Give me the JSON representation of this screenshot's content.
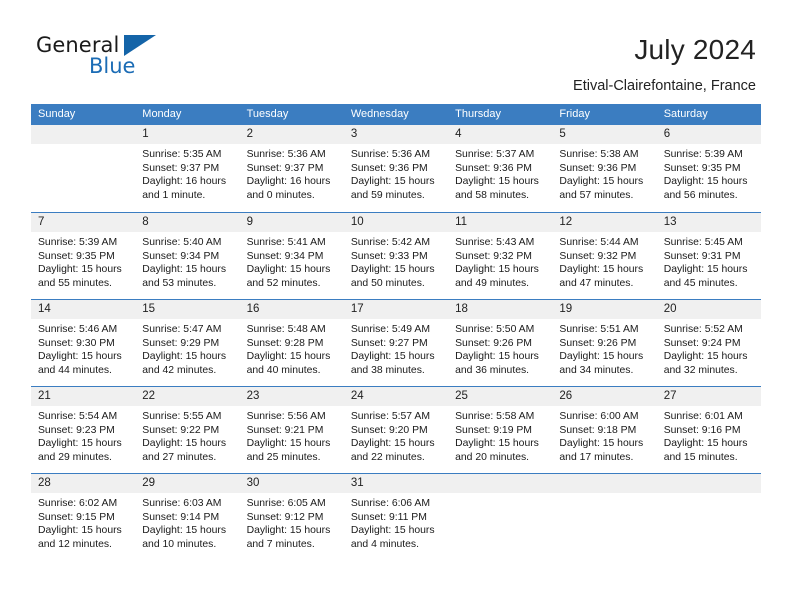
{
  "brand": {
    "name_part1": "General",
    "name_part2": "Blue",
    "triangle_icon": "triangle-icon",
    "accent_color": "#1464a8"
  },
  "header": {
    "title": "July 2024",
    "subtitle": "Etival-Clairefontaine, France"
  },
  "calendar": {
    "header_bg_color": "#3b7dc1",
    "daynum_bg_color": "#f0f0f0",
    "weekdays": [
      "Sunday",
      "Monday",
      "Tuesday",
      "Wednesday",
      "Thursday",
      "Friday",
      "Saturday"
    ],
    "weeks": [
      [
        {
          "day": "",
          "sunrise": "",
          "sunset": "",
          "daylight": ""
        },
        {
          "day": "1",
          "sunrise": "Sunrise: 5:35 AM",
          "sunset": "Sunset: 9:37 PM",
          "daylight": "Daylight: 16 hours and 1 minute."
        },
        {
          "day": "2",
          "sunrise": "Sunrise: 5:36 AM",
          "sunset": "Sunset: 9:37 PM",
          "daylight": "Daylight: 16 hours and 0 minutes."
        },
        {
          "day": "3",
          "sunrise": "Sunrise: 5:36 AM",
          "sunset": "Sunset: 9:36 PM",
          "daylight": "Daylight: 15 hours and 59 minutes."
        },
        {
          "day": "4",
          "sunrise": "Sunrise: 5:37 AM",
          "sunset": "Sunset: 9:36 PM",
          "daylight": "Daylight: 15 hours and 58 minutes."
        },
        {
          "day": "5",
          "sunrise": "Sunrise: 5:38 AM",
          "sunset": "Sunset: 9:36 PM",
          "daylight": "Daylight: 15 hours and 57 minutes."
        },
        {
          "day": "6",
          "sunrise": "Sunrise: 5:39 AM",
          "sunset": "Sunset: 9:35 PM",
          "daylight": "Daylight: 15 hours and 56 minutes."
        }
      ],
      [
        {
          "day": "7",
          "sunrise": "Sunrise: 5:39 AM",
          "sunset": "Sunset: 9:35 PM",
          "daylight": "Daylight: 15 hours and 55 minutes."
        },
        {
          "day": "8",
          "sunrise": "Sunrise: 5:40 AM",
          "sunset": "Sunset: 9:34 PM",
          "daylight": "Daylight: 15 hours and 53 minutes."
        },
        {
          "day": "9",
          "sunrise": "Sunrise: 5:41 AM",
          "sunset": "Sunset: 9:34 PM",
          "daylight": "Daylight: 15 hours and 52 minutes."
        },
        {
          "day": "10",
          "sunrise": "Sunrise: 5:42 AM",
          "sunset": "Sunset: 9:33 PM",
          "daylight": "Daylight: 15 hours and 50 minutes."
        },
        {
          "day": "11",
          "sunrise": "Sunrise: 5:43 AM",
          "sunset": "Sunset: 9:32 PM",
          "daylight": "Daylight: 15 hours and 49 minutes."
        },
        {
          "day": "12",
          "sunrise": "Sunrise: 5:44 AM",
          "sunset": "Sunset: 9:32 PM",
          "daylight": "Daylight: 15 hours and 47 minutes."
        },
        {
          "day": "13",
          "sunrise": "Sunrise: 5:45 AM",
          "sunset": "Sunset: 9:31 PM",
          "daylight": "Daylight: 15 hours and 45 minutes."
        }
      ],
      [
        {
          "day": "14",
          "sunrise": "Sunrise: 5:46 AM",
          "sunset": "Sunset: 9:30 PM",
          "daylight": "Daylight: 15 hours and 44 minutes."
        },
        {
          "day": "15",
          "sunrise": "Sunrise: 5:47 AM",
          "sunset": "Sunset: 9:29 PM",
          "daylight": "Daylight: 15 hours and 42 minutes."
        },
        {
          "day": "16",
          "sunrise": "Sunrise: 5:48 AM",
          "sunset": "Sunset: 9:28 PM",
          "daylight": "Daylight: 15 hours and 40 minutes."
        },
        {
          "day": "17",
          "sunrise": "Sunrise: 5:49 AM",
          "sunset": "Sunset: 9:27 PM",
          "daylight": "Daylight: 15 hours and 38 minutes."
        },
        {
          "day": "18",
          "sunrise": "Sunrise: 5:50 AM",
          "sunset": "Sunset: 9:26 PM",
          "daylight": "Daylight: 15 hours and 36 minutes."
        },
        {
          "day": "19",
          "sunrise": "Sunrise: 5:51 AM",
          "sunset": "Sunset: 9:26 PM",
          "daylight": "Daylight: 15 hours and 34 minutes."
        },
        {
          "day": "20",
          "sunrise": "Sunrise: 5:52 AM",
          "sunset": "Sunset: 9:24 PM",
          "daylight": "Daylight: 15 hours and 32 minutes."
        }
      ],
      [
        {
          "day": "21",
          "sunrise": "Sunrise: 5:54 AM",
          "sunset": "Sunset: 9:23 PM",
          "daylight": "Daylight: 15 hours and 29 minutes."
        },
        {
          "day": "22",
          "sunrise": "Sunrise: 5:55 AM",
          "sunset": "Sunset: 9:22 PM",
          "daylight": "Daylight: 15 hours and 27 minutes."
        },
        {
          "day": "23",
          "sunrise": "Sunrise: 5:56 AM",
          "sunset": "Sunset: 9:21 PM",
          "daylight": "Daylight: 15 hours and 25 minutes."
        },
        {
          "day": "24",
          "sunrise": "Sunrise: 5:57 AM",
          "sunset": "Sunset: 9:20 PM",
          "daylight": "Daylight: 15 hours and 22 minutes."
        },
        {
          "day": "25",
          "sunrise": "Sunrise: 5:58 AM",
          "sunset": "Sunset: 9:19 PM",
          "daylight": "Daylight: 15 hours and 20 minutes."
        },
        {
          "day": "26",
          "sunrise": "Sunrise: 6:00 AM",
          "sunset": "Sunset: 9:18 PM",
          "daylight": "Daylight: 15 hours and 17 minutes."
        },
        {
          "day": "27",
          "sunrise": "Sunrise: 6:01 AM",
          "sunset": "Sunset: 9:16 PM",
          "daylight": "Daylight: 15 hours and 15 minutes."
        }
      ],
      [
        {
          "day": "28",
          "sunrise": "Sunrise: 6:02 AM",
          "sunset": "Sunset: 9:15 PM",
          "daylight": "Daylight: 15 hours and 12 minutes."
        },
        {
          "day": "29",
          "sunrise": "Sunrise: 6:03 AM",
          "sunset": "Sunset: 9:14 PM",
          "daylight": "Daylight: 15 hours and 10 minutes."
        },
        {
          "day": "30",
          "sunrise": "Sunrise: 6:05 AM",
          "sunset": "Sunset: 9:12 PM",
          "daylight": "Daylight: 15 hours and 7 minutes."
        },
        {
          "day": "31",
          "sunrise": "Sunrise: 6:06 AM",
          "sunset": "Sunset: 9:11 PM",
          "daylight": "Daylight: 15 hours and 4 minutes."
        },
        {
          "day": "",
          "sunrise": "",
          "sunset": "",
          "daylight": ""
        },
        {
          "day": "",
          "sunrise": "",
          "sunset": "",
          "daylight": ""
        },
        {
          "day": "",
          "sunrise": "",
          "sunset": "",
          "daylight": ""
        }
      ]
    ]
  }
}
